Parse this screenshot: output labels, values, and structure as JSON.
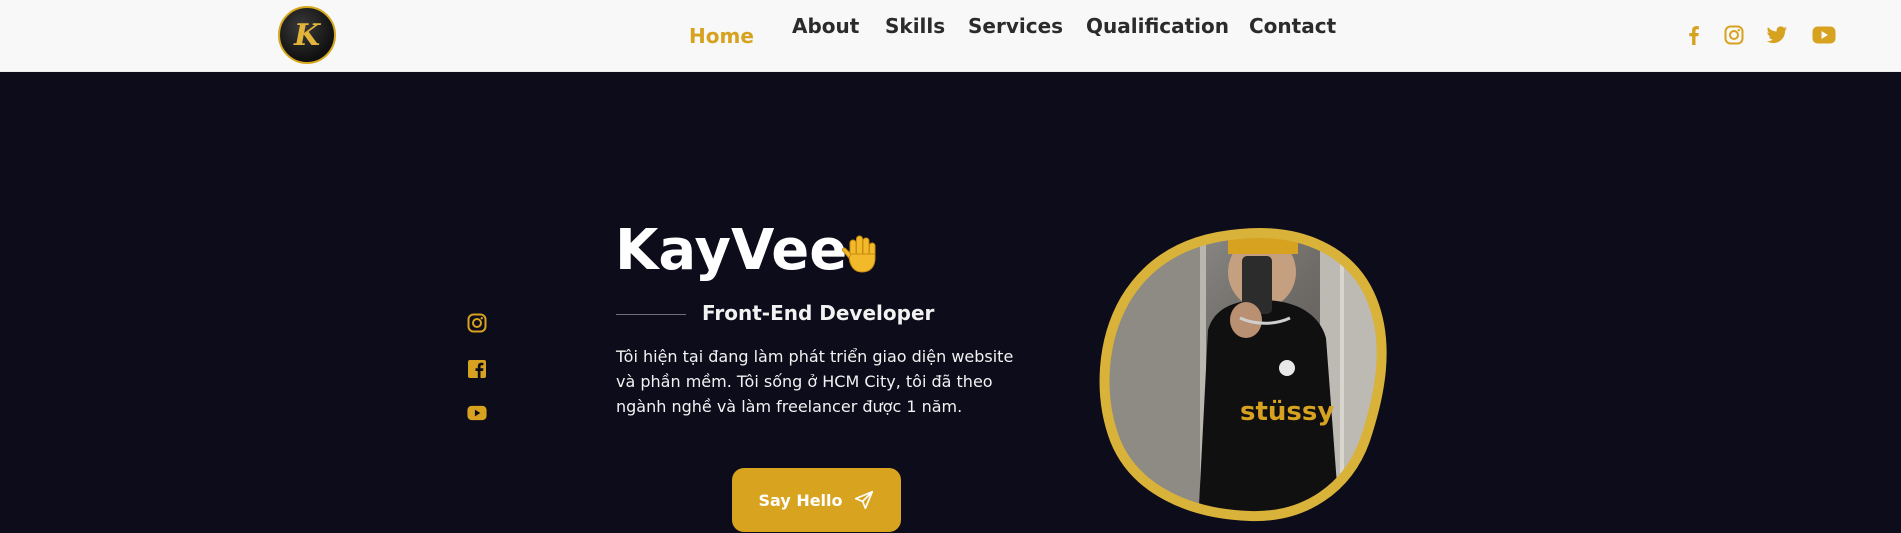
{
  "header": {
    "logo_letter": "K",
    "nav": [
      {
        "label": "Home",
        "active": true
      },
      {
        "label": "About",
        "active": false
      },
      {
        "label": "Skills",
        "active": false
      },
      {
        "label": "Services",
        "active": false
      },
      {
        "label": "Qualification",
        "active": false
      },
      {
        "label": "Contact",
        "active": false
      }
    ],
    "social_icons": [
      "facebook-icon",
      "instagram-icon",
      "twitter-icon",
      "youtube-icon"
    ]
  },
  "hero": {
    "name": "KayVee",
    "subtitle": "Front-End Developer",
    "description": "Tôi hiện tại đang làm phát triển giao diện website và phần mềm. Tôi sống ở HCM City, tôi đã theo ngành nghề và làm freelancer được 1 năm.",
    "cta_label": "Say Hello",
    "side_social": [
      "instagram-icon",
      "facebook-icon",
      "youtube-icon"
    ],
    "profile_shirt_text": "stüssy"
  },
  "colors": {
    "accent": "#d6a21f",
    "background": "#0c0c1b",
    "header_bg": "#f8f8f8",
    "text_dark": "#2b2b2b",
    "text_light": "#ffffff"
  }
}
